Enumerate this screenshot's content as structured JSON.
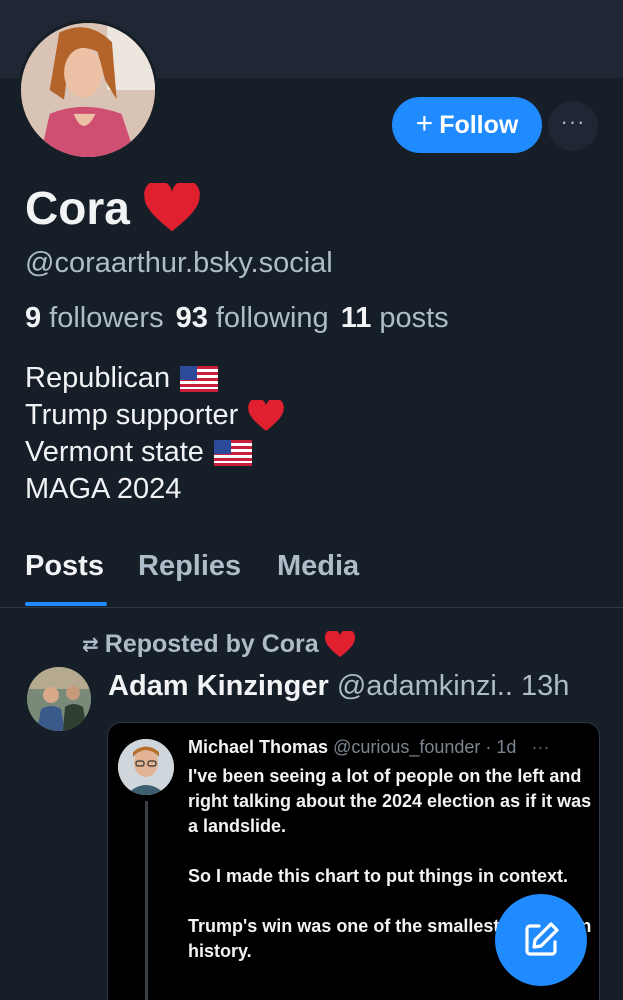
{
  "profile": {
    "display_name": "Cora",
    "handle": "@coraarthur.bsky.social",
    "followers_count": "9",
    "followers_label": "followers",
    "following_count": "93",
    "following_label": "following",
    "posts_count": "11",
    "posts_label": "posts",
    "bio": [
      {
        "text": "Republican",
        "emoji": "flag-icon"
      },
      {
        "text": "Trump supporter",
        "emoji": "heart-icon"
      },
      {
        "text": "Vermont state",
        "emoji": "flag-icon"
      },
      {
        "text": "MAGA 2024",
        "emoji": ""
      }
    ]
  },
  "actions": {
    "follow_label": "Follow",
    "more_label": "···"
  },
  "tabs": [
    {
      "label": "Posts",
      "active": true
    },
    {
      "label": "Replies",
      "active": false
    },
    {
      "label": "Media",
      "active": false
    }
  ],
  "feed": {
    "repost_label": "Reposted by Cora",
    "post": {
      "author": "Adam Kinzinger",
      "handle_time": "@adamkinzi.. 13h",
      "embed": {
        "author": "Michael Thomas",
        "meta": "@curious_founder · 1d",
        "dots": "···",
        "paragraphs": [
          "I've been seeing a lot of people on the left and right talking about the 2024 election as if it was a landslide.",
          "So I made this chart to put things in context.",
          "Trump's win was one of the smallest in modern history."
        ]
      }
    }
  },
  "colors": {
    "background": "#161e27",
    "accent": "#208bfe",
    "muted_text": "#aebbc9",
    "heart": "#e0202e"
  }
}
